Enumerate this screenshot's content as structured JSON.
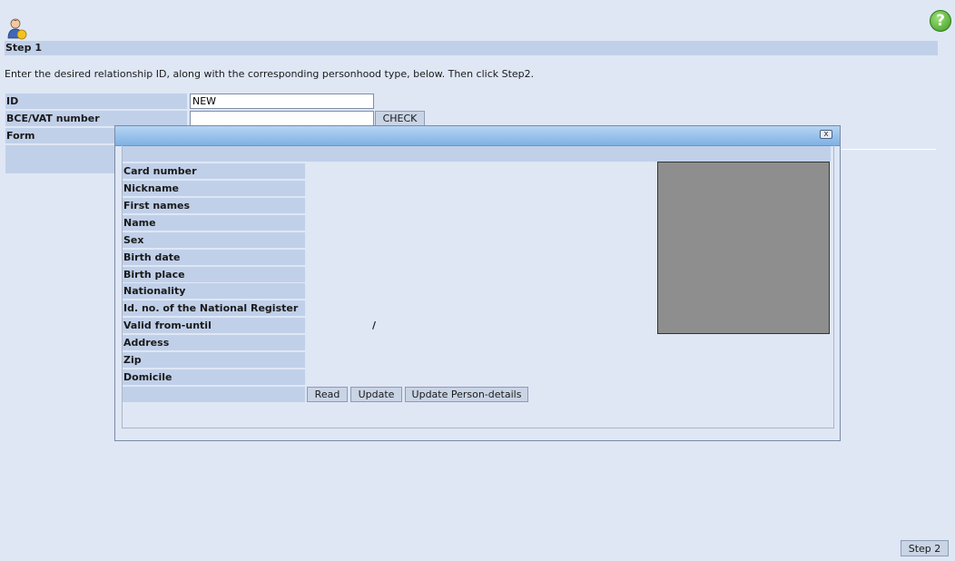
{
  "step1": {
    "title": "Step 1",
    "instruction": "Enter the desired relationship ID, along with the corresponding personhood type, below. Then click Step2."
  },
  "form": {
    "id_label": "ID",
    "id_value": "NEW",
    "vat_label": "BCE/VAT number",
    "vat_value": "",
    "check_button": "CHECK",
    "form_label": "Form"
  },
  "modal": {
    "fields": [
      {
        "label": "Card number",
        "value": ""
      },
      {
        "label": "Nickname",
        "value": ""
      },
      {
        "label": "First names",
        "value": ""
      },
      {
        "label": "Name",
        "value": ""
      },
      {
        "label": "Sex",
        "value": ""
      },
      {
        "label": "Birth date",
        "value": ""
      },
      {
        "label": "Birth place",
        "value": ""
      },
      {
        "label": "Nationality",
        "value": ""
      },
      {
        "label": "Id. no. of the National Register",
        "value": ""
      },
      {
        "label": "Valid from-until",
        "value": "/"
      },
      {
        "label": "Address",
        "value": ""
      },
      {
        "label": "Zip",
        "value": ""
      },
      {
        "label": "Domicile",
        "value": ""
      }
    ],
    "buttons": {
      "read": "Read",
      "update": "Update",
      "update_person": "Update Person-details"
    }
  },
  "footer": {
    "step2_button": "Step 2"
  },
  "icons": {
    "user": "user-icon",
    "help": "help-icon",
    "close": "close-icon"
  },
  "help_glyph": "?",
  "close_glyph": "x"
}
